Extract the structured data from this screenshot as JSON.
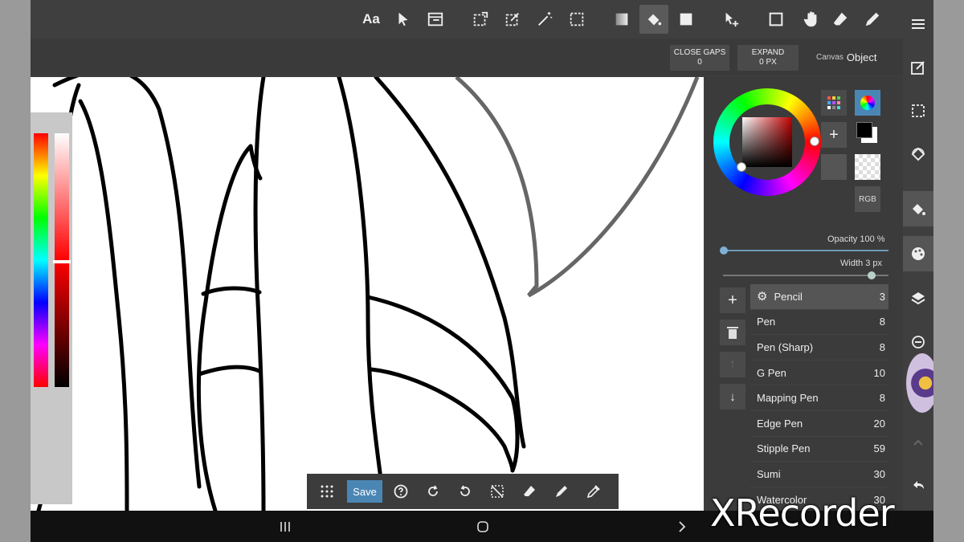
{
  "top_tools": [
    {
      "name": "text-tool",
      "label": "Aa"
    },
    {
      "name": "select-arrow-tool"
    },
    {
      "name": "filter-tool"
    },
    {
      "name": "transform-tool"
    },
    {
      "name": "edit-tool"
    },
    {
      "name": "magic-wand-tool"
    },
    {
      "name": "selection-tool"
    },
    {
      "name": "gradient-tool"
    },
    {
      "name": "fill-bucket-tool"
    },
    {
      "name": "shape-fill-tool"
    },
    {
      "name": "move-tool"
    },
    {
      "name": "square-tool"
    },
    {
      "name": "hand-tool"
    },
    {
      "name": "eraser-tool"
    },
    {
      "name": "pen-tool"
    }
  ],
  "subbar": {
    "close_gaps_label": "CLOSE GAPS",
    "close_gaps_value": "0",
    "expand_label": "EXPAND",
    "expand_value": "0 PX",
    "mode_canvas": "Canvas",
    "mode_object": "Object"
  },
  "color_panel": {
    "rgb_label": "RGB",
    "opacity_label": "Opacity",
    "opacity_value": "100",
    "opacity_unit": "%",
    "opacity": 1.0,
    "width_label": "Width",
    "width_value": "3",
    "width_unit": "px",
    "width_fraction": 0.98,
    "current_color": "#000000",
    "wheel_hue_color": "#cc0000"
  },
  "brushes": [
    {
      "name": "Pencil",
      "size": "3",
      "selected": true
    },
    {
      "name": "Pen",
      "size": "8"
    },
    {
      "name": "Pen (Sharp)",
      "size": "8"
    },
    {
      "name": "G Pen",
      "size": "10"
    },
    {
      "name": "Mapping Pen",
      "size": "8"
    },
    {
      "name": "Edge Pen",
      "size": "20"
    },
    {
      "name": "Stipple Pen",
      "size": "59"
    },
    {
      "name": "Sumi",
      "size": "30"
    },
    {
      "name": "Watercolor",
      "size": "30"
    }
  ],
  "bottom": {
    "save_label": "Save"
  },
  "watermark": "XRecorder",
  "colors": {
    "toolbar": "#3f3f3f",
    "accent": "#4a86b4",
    "canvas": "#ffffff"
  }
}
